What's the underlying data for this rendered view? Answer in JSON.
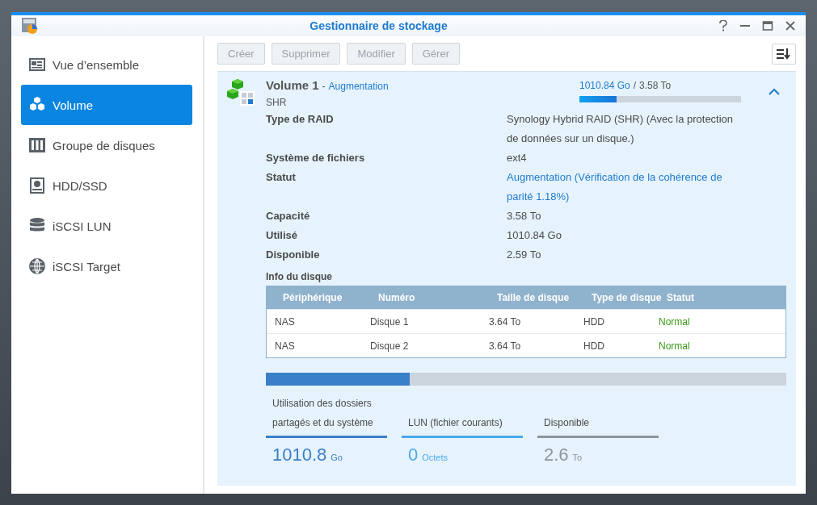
{
  "window": {
    "title": "Gestionnaire de stockage"
  },
  "sidebar": {
    "items": [
      {
        "label": "Vue d’ensemble",
        "kind": "overview",
        "selected": false
      },
      {
        "label": "Volume",
        "kind": "volume",
        "selected": true
      },
      {
        "label": "Groupe de disques",
        "kind": "group",
        "selected": false
      },
      {
        "label": "HDD/SSD",
        "kind": "hdd",
        "selected": false
      },
      {
        "label": "iSCSI LUN",
        "kind": "lun",
        "selected": false
      },
      {
        "label": "iSCSI Target",
        "kind": "target",
        "selected": false
      }
    ]
  },
  "toolbar": {
    "buttons": [
      {
        "label": "Créer",
        "disabled": true
      },
      {
        "label": "Supprimer",
        "disabled": true
      },
      {
        "label": "Modifier",
        "disabled": true
      },
      {
        "label": "Gérer",
        "disabled": true
      }
    ]
  },
  "volume": {
    "name": "Volume 1",
    "separator": "-",
    "state": "Augmentation",
    "type": "SHR",
    "used": "1010.84 Go",
    "slash": "/",
    "total": "3.58 To",
    "level": 0.23,
    "expanded": true,
    "details": [
      {
        "label": "Type de RAID",
        "value": "Synology Hybrid RAID (SHR) (Avec la protection de données sur un disque.)",
        "kind": "text"
      },
      {
        "label": "Système de fichiers",
        "value": "ext4",
        "kind": "text"
      },
      {
        "label": "Statut",
        "value": "Augmentation (Vérification de la cohérence de parité 1.18%)",
        "kind": "status"
      },
      {
        "label": "Capacité",
        "value": "3.58 To",
        "kind": "text"
      },
      {
        "label": "Utilisé",
        "value": "1010.84 Go",
        "kind": "text"
      },
      {
        "label": "Disponible",
        "value": "2.59 To",
        "kind": "text"
      }
    ],
    "disk_info": {
      "title": "Info du disque",
      "columns": [
        "Périphérique",
        "Numéro",
        "Taille de disque",
        "Type de disque",
        "Statut"
      ],
      "rows": [
        [
          "NAS",
          "Disque 1",
          "3.64 To",
          "HDD",
          "Normal"
        ],
        [
          "NAS",
          "Disque 2",
          "3.64 To",
          "HDD",
          "Normal"
        ]
      ]
    },
    "usage": {
      "level": 0.276,
      "legend": [
        {
          "label": "Utilisation des dossiers partagés et du système",
          "value": "1010.8",
          "unit": "Go",
          "color": "#3a7fc9"
        },
        {
          "label": "LUN (fichier courants)",
          "value": "0",
          "unit": "Octets",
          "color": "#4aa8ee"
        },
        {
          "label": "Disponible",
          "value": "2.6",
          "unit": "To",
          "color": "#8c949c"
        }
      ]
    }
  }
}
